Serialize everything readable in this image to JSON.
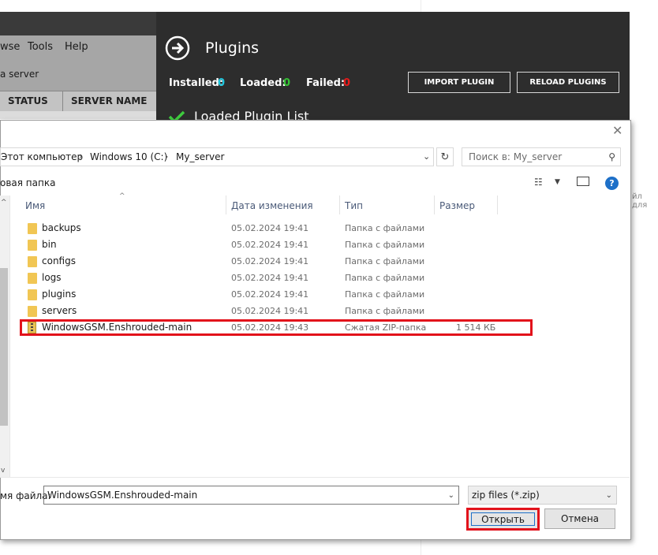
{
  "background_app": {
    "menu": [
      "wse",
      "Tools",
      "Help"
    ],
    "sub_text": "a server",
    "columns": [
      "STATUS",
      "SERVER NAME"
    ],
    "panel_title": "Plugins",
    "installed_label": "Installed:",
    "installed_value": "0",
    "loaded_label": "Loaded:",
    "loaded_value": "0",
    "failed_label": "Failed:",
    "failed_value": "0",
    "import_button": "IMPORT PLUGIN",
    "reload_button": "RELOAD PLUGINS",
    "list_title": "Loaded Plugin List",
    "right_hint": "йл для"
  },
  "dialog": {
    "breadcrumb": [
      "Этот компьютер",
      "Windows 10 (C:)",
      "My_server"
    ],
    "search_placeholder": "Поиск в: My_server",
    "new_folder_label": "овая папка",
    "columns": {
      "name": "Имя",
      "date": "Дата изменения",
      "type": "Тип",
      "size": "Размер"
    },
    "files": [
      {
        "name": "backups",
        "date": "05.02.2024 19:41",
        "type": "Папка с файлами",
        "size": ""
      },
      {
        "name": "bin",
        "date": "05.02.2024 19:41",
        "type": "Папка с файлами",
        "size": ""
      },
      {
        "name": "configs",
        "date": "05.02.2024 19:41",
        "type": "Папка с файлами",
        "size": ""
      },
      {
        "name": "logs",
        "date": "05.02.2024 19:41",
        "type": "Папка с файлами",
        "size": ""
      },
      {
        "name": "plugins",
        "date": "05.02.2024 19:41",
        "type": "Папка с файлами",
        "size": ""
      },
      {
        "name": "servers",
        "date": "05.02.2024 19:41",
        "type": "Папка с файлами",
        "size": ""
      },
      {
        "name": "WindowsGSM.Enshrouded-main",
        "date": "05.02.2024 19:43",
        "type": "Сжатая ZIP-папка",
        "size": "1 514 КБ"
      }
    ],
    "filename_label": "мя файла:",
    "filename_value": "WindowsGSM.Enshrouded-main",
    "filetype_value": "zip files (*.zip)",
    "open_button": "Открыть",
    "cancel_button": "Отмена"
  },
  "colors": {
    "app_dark": "#2d2d2d",
    "counter_cyan": "#1ec8e0",
    "counter_green": "#35c435",
    "counter_red": "#e81a1a",
    "highlight_red": "#e2121b",
    "check_green": "#3ecb3e"
  }
}
